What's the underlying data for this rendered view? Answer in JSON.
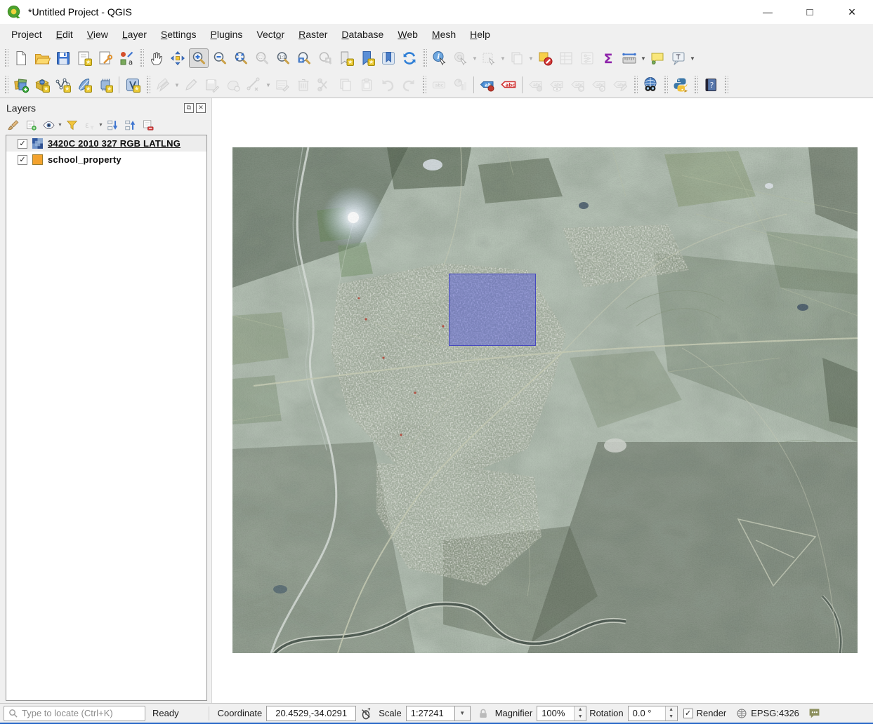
{
  "window": {
    "title": "*Untitled Project - QGIS",
    "controls": {
      "minimize_glyph": "—",
      "maximize_glyph": "□",
      "close_glyph": "×"
    }
  },
  "menu": {
    "items": [
      {
        "label": "Project",
        "u": 3
      },
      {
        "label": "Edit",
        "u": 0
      },
      {
        "label": "View",
        "u": 0
      },
      {
        "label": "Layer",
        "u": 0
      },
      {
        "label": "Settings",
        "u": 0
      },
      {
        "label": "Plugins",
        "u": 0
      },
      {
        "label": "Vector",
        "u": 4
      },
      {
        "label": "Raster",
        "u": 0
      },
      {
        "label": "Database",
        "u": 0
      },
      {
        "label": "Web",
        "u": 0
      },
      {
        "label": "Mesh",
        "u": 0
      },
      {
        "label": "Help",
        "u": 0
      }
    ]
  },
  "toolbars": {
    "row1": [
      {
        "t": "grip"
      },
      {
        "n": "new-project",
        "g": "file-new"
      },
      {
        "n": "open-project",
        "g": "folder-open"
      },
      {
        "n": "save-project",
        "g": "save"
      },
      {
        "n": "new-print-layout",
        "g": "layout-new"
      },
      {
        "n": "show-layout-manager",
        "g": "layout-manager"
      },
      {
        "n": "style-manager",
        "g": "style-manager"
      },
      {
        "t": "grip"
      },
      {
        "n": "pan-map",
        "g": "pan-hand"
      },
      {
        "n": "pan-map-to-selection",
        "g": "pan-selection"
      },
      {
        "n": "zoom-in",
        "g": "zoom-in",
        "p": true
      },
      {
        "n": "zoom-out",
        "g": "zoom-out"
      },
      {
        "n": "zoom-full-extent",
        "g": "zoom-full"
      },
      {
        "n": "zoom-to-selection",
        "g": "zoom-selection",
        "d": true
      },
      {
        "n": "zoom-to-native-resolution",
        "g": "zoom-native"
      },
      {
        "n": "zoom-last",
        "g": "zoom-last"
      },
      {
        "n": "zoom-next",
        "g": "zoom-next",
        "d": true
      },
      {
        "n": "new-spatial-bookmark",
        "g": "bookmark-new"
      },
      {
        "n": "show-spatial-bookmarks",
        "g": "bookmark-show"
      },
      {
        "n": "show-bookmark-manager",
        "g": "bookmark-manager"
      },
      {
        "n": "refresh-map",
        "g": "refresh"
      },
      {
        "t": "grip"
      },
      {
        "n": "identify-features",
        "g": "identify"
      },
      {
        "n": "run-feature-action",
        "g": "feature-action",
        "d": true,
        "dd": true
      },
      {
        "n": "select-features",
        "g": "select-features",
        "d": true,
        "dd": true
      },
      {
        "n": "select-features-by-value",
        "g": "select-pages",
        "d": true,
        "dd": true
      },
      {
        "n": "deselect-features-from-all-layers",
        "g": "deselect-all"
      },
      {
        "n": "open-attribute-table",
        "g": "attr-table",
        "d": true
      },
      {
        "n": "open-field-calculator",
        "g": "field-calc",
        "d": true
      },
      {
        "n": "show-statistical-summary",
        "g": "sigma"
      },
      {
        "n": "measure-line",
        "g": "measure",
        "dd": true
      },
      {
        "n": "show-map-tips",
        "g": "map-tips"
      },
      {
        "n": "text-annotation",
        "g": "annotation",
        "dd": true
      }
    ],
    "row2": [
      {
        "t": "grip"
      },
      {
        "n": "open-data-source-manager",
        "g": "dsm"
      },
      {
        "n": "new-geopackage-layer",
        "g": "new-gpkg"
      },
      {
        "n": "new-shapefile-layer",
        "g": "new-shp"
      },
      {
        "n": "new-spatialite-layer",
        "g": "new-spatialite"
      },
      {
        "n": "new-temporary-scratch-layer",
        "g": "new-scratch"
      },
      {
        "t": "sep"
      },
      {
        "n": "new-virtual-layer",
        "g": "new-virtual"
      },
      {
        "t": "grip"
      },
      {
        "n": "current-edits",
        "g": "current-edits",
        "d": true,
        "dd": true
      },
      {
        "n": "toggle-editing",
        "g": "pencil",
        "d": true
      },
      {
        "n": "save-layer-edits",
        "g": "save-edits",
        "d": true
      },
      {
        "n": "add-feature",
        "g": "digitize",
        "d": true
      },
      {
        "n": "vertex-tool",
        "g": "vertex",
        "d": true,
        "dd": true
      },
      {
        "n": "modify-attributes-of-selected-features",
        "g": "multiedit",
        "d": true
      },
      {
        "n": "delete-selected",
        "g": "trash",
        "d": true
      },
      {
        "n": "cut-features",
        "g": "scissors",
        "d": true
      },
      {
        "n": "copy-features",
        "g": "copy",
        "d": true
      },
      {
        "n": "paste-features",
        "g": "paste",
        "d": true
      },
      {
        "n": "undo",
        "g": "undo",
        "d": true
      },
      {
        "n": "redo",
        "g": "redo",
        "d": true
      },
      {
        "t": "grip"
      },
      {
        "n": "layer-labeling-options",
        "g": "label-abc",
        "d": true
      },
      {
        "n": "layer-diagram-options",
        "g": "diagram",
        "d": true
      },
      {
        "t": "sep"
      },
      {
        "n": "highlight-pinned-labels-and-diagrams",
        "g": "label-pin-blue"
      },
      {
        "n": "show-hidden-labels-and-diagrams",
        "g": "label-abc-red"
      },
      {
        "t": "sep"
      },
      {
        "n": "pin-unpin-labels-and-diagrams",
        "g": "label-pin",
        "d": true
      },
      {
        "n": "show-hide-labels-and-diagrams",
        "g": "label-eye",
        "d": true
      },
      {
        "n": "move-label-and-diagram",
        "g": "label-move",
        "d": true
      },
      {
        "n": "rotate-label",
        "g": "label-rotate",
        "d": true
      },
      {
        "n": "change-label-properties",
        "g": "label-edit",
        "d": true
      },
      {
        "t": "grip"
      },
      {
        "n": "metasearch",
        "g": "metasearch"
      },
      {
        "t": "grip"
      },
      {
        "n": "python-console",
        "g": "python"
      },
      {
        "t": "grip"
      },
      {
        "n": "help-contents",
        "g": "help"
      },
      {
        "t": "grip"
      }
    ]
  },
  "layers_panel": {
    "title": "Layers",
    "tools": [
      {
        "n": "open-layer-styling-panel",
        "g": "brush"
      },
      {
        "n": "add-group",
        "g": "add-group"
      },
      {
        "n": "manage-map-themes",
        "g": "themes-eye",
        "dd": true
      },
      {
        "n": "filter-legend",
        "g": "filter"
      },
      {
        "n": "filter-legend-by-expression",
        "g": "expr-filter",
        "d": true,
        "dd": true
      },
      {
        "n": "expand-all",
        "g": "expand-all"
      },
      {
        "n": "collapse-all",
        "g": "collapse-all"
      },
      {
        "n": "remove-layer-group",
        "g": "remove-layer"
      }
    ],
    "layers": [
      {
        "label": "3420C 2010 327 RGB LATLNG",
        "checked": true,
        "selected": true,
        "kind": "raster"
      },
      {
        "label": "school_property",
        "checked": true,
        "selected": false,
        "kind": "vector",
        "swatch_color": "#f3a22d"
      }
    ]
  },
  "map": {
    "selection_fill": "#484edd",
    "checkmark_glyph": "✓"
  },
  "status_bar": {
    "locate_placeholder": "Type to locate (Ctrl+K)",
    "ready": "Ready",
    "coordinate_label": "Coordinate",
    "coordinate_value": "20.4529,-34.0291",
    "scale_label": "Scale",
    "scale_value": "1:27241",
    "magnifier_label": "Magnifier",
    "magnifier_value": "100%",
    "rotation_label": "Rotation",
    "rotation_value": "0.0 °",
    "render_label": "Render",
    "crs": "EPSG:4326"
  }
}
